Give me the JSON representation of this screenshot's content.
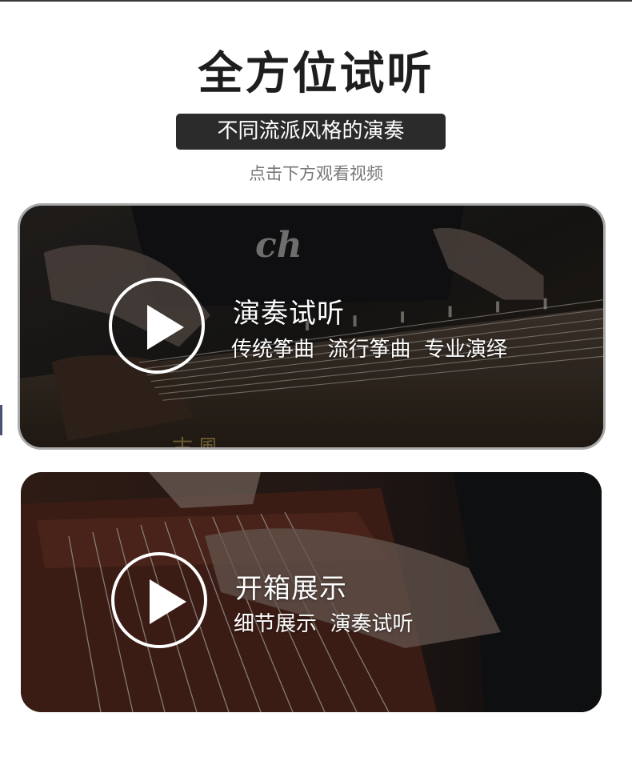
{
  "header": {
    "title": "全方位试听",
    "subtitle": "不同流派风格的演奏",
    "hint": "点击下方观看视频"
  },
  "videos": [
    {
      "title": "演奏试听",
      "subtitle": "传统筝曲  流行筝曲  专业演绎",
      "icon": "play-icon",
      "watermark": "ch",
      "decor_text": "古風"
    },
    {
      "title": "开箱展示",
      "subtitle": "细节展示  演奏试听",
      "icon": "play-icon"
    }
  ],
  "colors": {
    "title": "#1e1e1e",
    "pill_bg": "#2b2b2b",
    "hint": "#777777",
    "overlay_text": "#ffffff",
    "card_border": "#a9a9a9"
  }
}
